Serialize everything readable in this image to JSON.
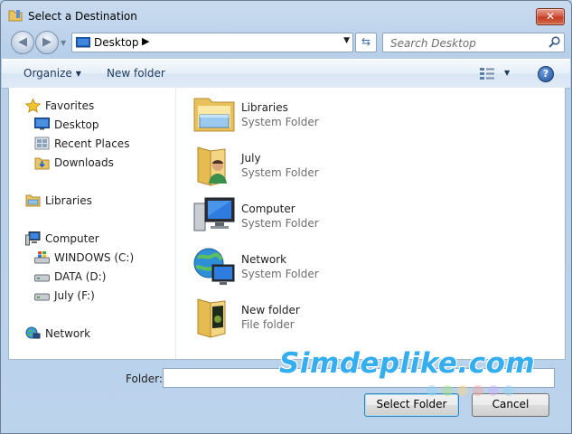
{
  "window": {
    "title": "Select a Destination",
    "close_label": "✕"
  },
  "navbar": {
    "address_crumb": "Desktop",
    "address_sep": "▶",
    "search_placeholder": "Search Desktop"
  },
  "toolbar": {
    "organize_label": "Organize",
    "new_folder_label": "New folder",
    "help_label": "?"
  },
  "navpane": {
    "favorites": "Favorites",
    "desktop": "Desktop",
    "recent_places": "Recent Places",
    "downloads": "Downloads",
    "libraries": "Libraries",
    "computer": "Computer",
    "drive_c": "WINDOWS (C:)",
    "drive_d": "DATA (D:)",
    "drive_f": "July (F:)",
    "network": "Network"
  },
  "files": [
    {
      "name": "Libraries",
      "type": "System Folder",
      "icon": "libraries-icon"
    },
    {
      "name": "July",
      "type": "System Folder",
      "icon": "user-folder-icon"
    },
    {
      "name": "Computer",
      "type": "System Folder",
      "icon": "computer-icon"
    },
    {
      "name": "Network",
      "type": "System Folder",
      "icon": "network-icon"
    },
    {
      "name": "New folder",
      "type": "File folder",
      "icon": "folder-icon"
    }
  ],
  "footer": {
    "folder_label": "Folder:",
    "folder_value": "",
    "select_button": "Select Folder",
    "cancel_button": "Cancel"
  },
  "watermark": "Simdeplike.com",
  "colors": {
    "accent": "#1e395b",
    "watermark": "#35aef0",
    "close": "#c23b22"
  }
}
